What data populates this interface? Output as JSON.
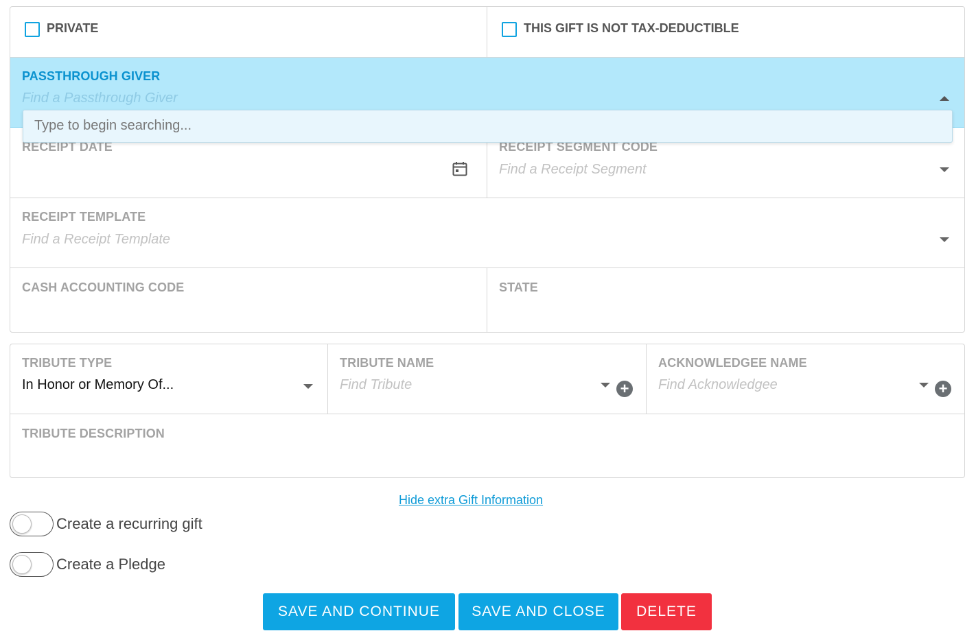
{
  "checkboxes": {
    "private_label": "PRIVATE",
    "not_tax_deductible_label": "THIS GIFT IS NOT TAX-DEDUCTIBLE"
  },
  "passthrough": {
    "label": "PASSTHROUGH GIVER",
    "placeholder": "Find a Passthrough Giver",
    "dropdown_hint": "Type to begin searching..."
  },
  "receipt": {
    "date_label": "RECEIPT DATE",
    "segment_label": "RECEIPT SEGMENT CODE",
    "segment_placeholder": "Find a Receipt Segment",
    "template_label": "RECEIPT TEMPLATE",
    "template_placeholder": "Find a Receipt Template"
  },
  "accounting": {
    "cash_code_label": "CASH ACCOUNTING CODE",
    "state_label": "STATE"
  },
  "tribute": {
    "type_label": "TRIBUTE TYPE",
    "type_value": "In Honor or Memory Of...",
    "name_label": "TRIBUTE NAME",
    "name_placeholder": "Find Tribute",
    "acknowledgee_label": "ACKNOWLEDGEE NAME",
    "acknowledgee_placeholder": "Find Acknowledgee",
    "description_label": "TRIBUTE DESCRIPTION"
  },
  "links": {
    "hide_extra": "Hide extra Gift Information"
  },
  "toggles": {
    "recurring_label": "Create a recurring gift",
    "pledge_label": "Create a Pledge"
  },
  "buttons": {
    "save_continue": "SAVE AND CONTINUE",
    "save_close": "SAVE AND CLOSE",
    "delete": "DELETE"
  },
  "colors": {
    "accent": "#0ea5e3",
    "danger": "#f2313f",
    "active_field_bg": "#b3e8fb"
  }
}
